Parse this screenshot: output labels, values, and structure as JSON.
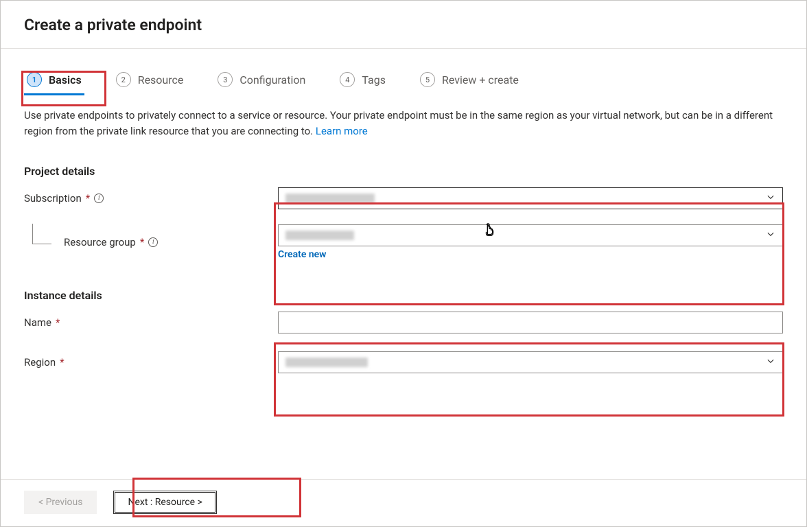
{
  "header": {
    "title": "Create a private endpoint"
  },
  "tabs": [
    {
      "num": "1",
      "label": "Basics"
    },
    {
      "num": "2",
      "label": "Resource"
    },
    {
      "num": "3",
      "label": "Configuration"
    },
    {
      "num": "4",
      "label": "Tags"
    },
    {
      "num": "5",
      "label": "Review + create"
    }
  ],
  "intro": {
    "text": "Use private endpoints to privately connect to a service or resource. Your private endpoint must be in the same region as your virtual network, but can be in a different region from the private link resource that you are connecting to.  ",
    "learn_more": "Learn more"
  },
  "sections": {
    "project": {
      "title": "Project details",
      "subscription_label": "Subscription",
      "resource_group_label": "Resource group",
      "create_new": "Create new"
    },
    "instance": {
      "title": "Instance details",
      "name_label": "Name",
      "region_label": "Region"
    }
  },
  "fields": {
    "subscription": "",
    "resource_group": "",
    "name": "",
    "region": ""
  },
  "footer": {
    "previous": "< Previous",
    "next": "Next : Resource >"
  }
}
